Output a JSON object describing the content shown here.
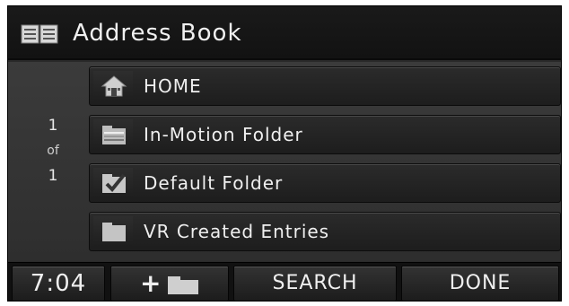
{
  "header": {
    "title": "Address Book",
    "icon": "address-book-icon"
  },
  "pager": {
    "current": "1",
    "of_label": "of",
    "total": "1"
  },
  "items": [
    {
      "label": "HOME",
      "icon": "home-icon"
    },
    {
      "label": "In-Motion Folder",
      "icon": "folder-stack-icon"
    },
    {
      "label": "Default Folder",
      "icon": "checked-folder-icon"
    },
    {
      "label": "VR Created Entries",
      "icon": "folder-icon"
    }
  ],
  "footer": {
    "time": "7:04",
    "add_label": "+",
    "search_label": "SEARCH",
    "done_label": "DONE"
  },
  "colors": {
    "background": "#2a2a2a",
    "text": "#efefef",
    "frame": "#ffffff"
  }
}
